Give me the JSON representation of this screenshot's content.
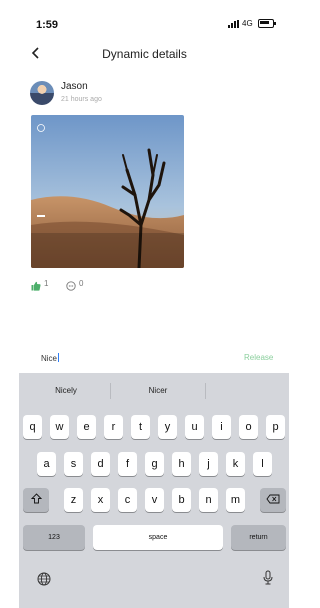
{
  "status_bar": {
    "time": "1:59",
    "network": "4G"
  },
  "header": {
    "title": "Dynamic details",
    "back_icon": "chevron-left-icon"
  },
  "post": {
    "author": "Jason",
    "time": "21 hours ago",
    "likes": "1",
    "comments": "0"
  },
  "comment_input": {
    "value": "Nice",
    "send_label": "Release"
  },
  "keyboard": {
    "suggestions": [
      "Nicely",
      "Nicer"
    ],
    "row1": [
      "q",
      "w",
      "e",
      "r",
      "t",
      "y",
      "u",
      "i",
      "o",
      "p"
    ],
    "row2": [
      "a",
      "s",
      "d",
      "f",
      "g",
      "h",
      "j",
      "k",
      "l"
    ],
    "row3": [
      "z",
      "x",
      "c",
      "v",
      "b",
      "n",
      "m"
    ],
    "numbers_label": "123",
    "space_label": "space",
    "return_label": "return"
  },
  "colors": {
    "accent_green": "#8bcf9d",
    "keyboard_bg": "#d4d6db"
  }
}
